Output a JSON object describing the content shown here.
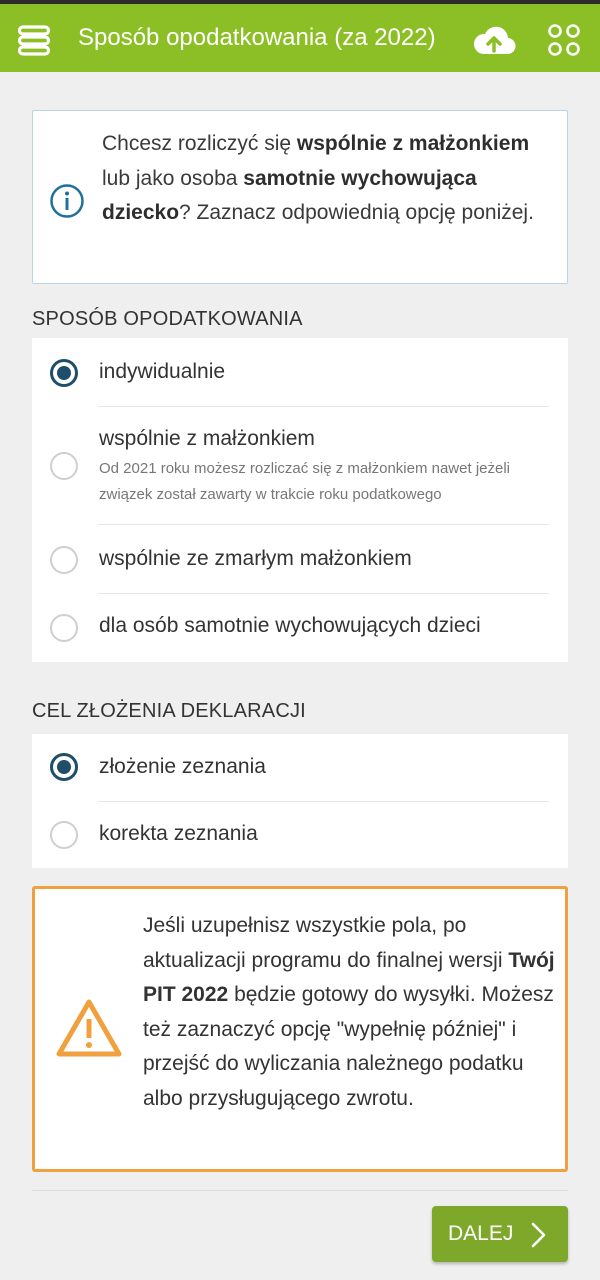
{
  "header": {
    "title": "Sposób opodatkowania (za 2022)",
    "icons": [
      "menu-icon",
      "cloud-upload-icon",
      "apps-grid-icon"
    ],
    "color": "#8cbf26"
  },
  "info": {
    "t1": "Chcesz rozliczyć się ",
    "t2": "wspólnie z małżonkiem",
    "t3": " lub jako osoba ",
    "t4": "samotnie wychowująca dziecko",
    "t5": "? Zaznacz odpowiednią opcję poniżej."
  },
  "taxation": {
    "section_title": "SPOSÓB OPODATKOWANIA",
    "options": [
      {
        "label": "indywidualnie",
        "selected": true
      },
      {
        "label": "wspólnie z małżonkiem",
        "description": "Od 2021 roku możesz rozliczać się z małżonkiem nawet jeżeli związek został zawarty w trakcie roku podatkowego",
        "selected": false
      },
      {
        "label": "wspólnie ze zmarłym małżonkiem",
        "selected": false
      },
      {
        "label": "dla osób samotnie wychowujących dzieci",
        "selected": false
      }
    ]
  },
  "purpose": {
    "section_title": "CEL ZŁOŻENIA DEKLARACJI",
    "options": [
      {
        "label": "złożenie zeznania",
        "selected": true
      },
      {
        "label": "korekta zeznania",
        "selected": false
      }
    ]
  },
  "warning": {
    "t1": "Jeśli uzupełnisz wszystkie pola, po aktualizacji programu do finalnej wersji ",
    "t2": "Twój PIT 2022",
    "t3": " będzie gotowy do wysyłki. Możesz też zaznaczyć opcję \"wypełnię później\" i przejść do wyliczania należnego podatku albo przysługującego zwrotu."
  },
  "footer": {
    "next_label": "DALEJ"
  },
  "colors": {
    "accent": "#8cbf26",
    "button": "#7ea82a",
    "radio_selected": "#1f4e6b",
    "warning_border": "#f0a03c",
    "info_border": "#b9d4e6"
  }
}
